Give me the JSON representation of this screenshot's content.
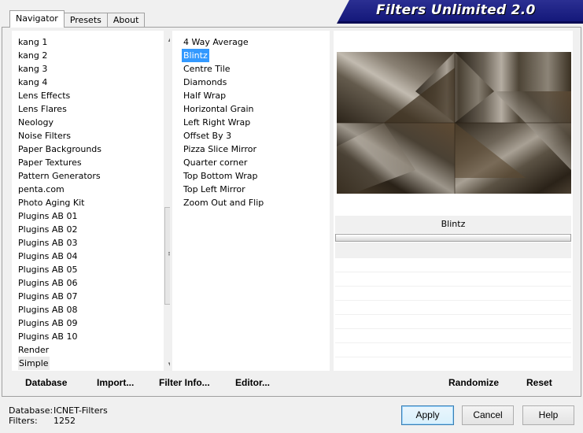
{
  "tabs": {
    "navigator": "Navigator",
    "presets": "Presets",
    "about": "About"
  },
  "banner": {
    "title": "Filters Unlimited 2.0"
  },
  "categories": {
    "items": [
      "kang 1",
      "kang 2",
      "kang 3",
      "kang 4",
      "Lens Effects",
      "Lens Flares",
      "Neology",
      "Noise Filters",
      "Paper Backgrounds",
      "Paper Textures",
      "Pattern Generators",
      "penta.com",
      "Photo Aging Kit",
      "Plugins AB 01",
      "Plugins AB 02",
      "Plugins AB 03",
      "Plugins AB 04",
      "Plugins AB 05",
      "Plugins AB 06",
      "Plugins AB 07",
      "Plugins AB 08",
      "Plugins AB 09",
      "Plugins AB 10",
      "Render",
      "Simple"
    ],
    "selected": "Simple"
  },
  "filters": {
    "items": [
      "4 Way Average",
      "Blintz",
      "Centre Tile",
      "Diamonds",
      "Half Wrap",
      "Horizontal Grain",
      "Left Right Wrap",
      "Offset By 3",
      "Pizza Slice Mirror",
      "Quarter corner",
      "Top Bottom Wrap",
      "Top Left Mirror",
      "Zoom Out and Flip"
    ],
    "selected": "Blintz"
  },
  "preview": {
    "filter_name": "Blintz"
  },
  "actions": {
    "database": "Database",
    "import": "Import...",
    "filter_info": "Filter Info...",
    "editor": "Editor...",
    "randomize": "Randomize",
    "reset": "Reset"
  },
  "status": {
    "database_label": "Database:",
    "database_value": "ICNET-Filters",
    "filters_label": "Filters:",
    "filters_value": "1252"
  },
  "buttons": {
    "apply": "Apply",
    "cancel": "Cancel",
    "help": "Help"
  },
  "colors": {
    "banner": "#1f237f",
    "selection": "#3399ff"
  }
}
